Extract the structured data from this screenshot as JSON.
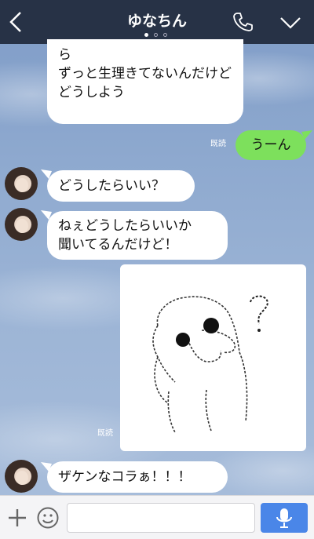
{
  "header": {
    "title": "ゆなちん",
    "page_indicator": {
      "pages": 3,
      "current": 1
    }
  },
  "messages": [
    {
      "side": "left",
      "text": "ら\nずっと生理きてないんだけど\nどうしよう"
    },
    {
      "side": "right",
      "text": "うーん",
      "read_label": "既読"
    },
    {
      "side": "left",
      "text": "どうしたらいい？"
    },
    {
      "side": "left",
      "text": "ねぇどうしたらいいか\n聞いてるんだけど！"
    },
    {
      "side": "right",
      "type": "sticker",
      "read_label": "既読"
    },
    {
      "side": "left",
      "text": "ザケンなコラぁ！！！"
    }
  ],
  "input": {
    "value": "",
    "placeholder": ""
  },
  "colors": {
    "header_bg": "#273246",
    "sent_bubble": "#7de05c",
    "received_bubble": "#ffffff",
    "send_button": "#4a86e8"
  },
  "icons": [
    "back-icon",
    "phone-icon",
    "chevron-down-icon",
    "plus-icon",
    "emoji-icon",
    "microphone-icon"
  ]
}
